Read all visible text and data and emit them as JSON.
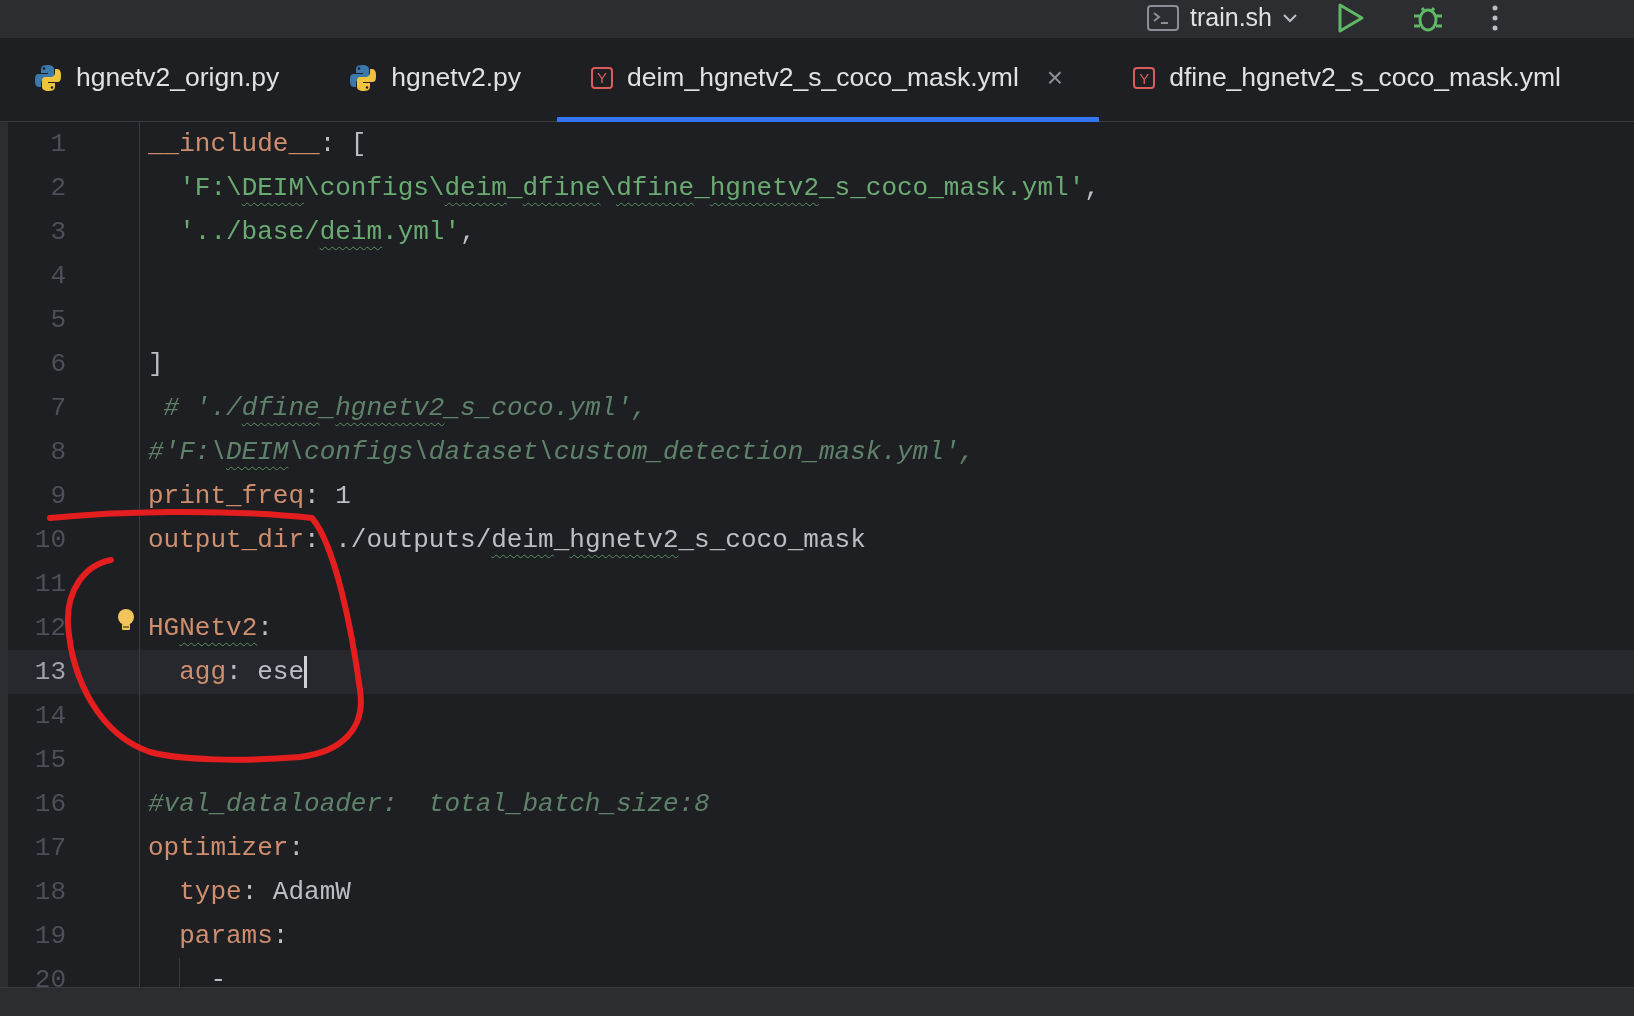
{
  "toolbar": {
    "run_config": {
      "label": "train.sh"
    },
    "buttons": [
      {
        "kind": "run"
      },
      {
        "kind": "debug"
      },
      {
        "kind": "more"
      }
    ]
  },
  "tabs": [
    {
      "label": "hgnetv2_orign.py",
      "kind": "python",
      "selected": false
    },
    {
      "label": "hgnetv2.py",
      "kind": "python",
      "selected": false
    },
    {
      "label": "deim_hgnetv2_s_coco_mask.yml",
      "kind": "yaml",
      "badge": "Y",
      "selected": true,
      "close": "×"
    },
    {
      "label": "dfine_hgnetv2_s_coco_mask.yml",
      "kind": "yaml",
      "badge": "Y",
      "selected": false
    }
  ],
  "lines": [
    {
      "number": "1",
      "current": false,
      "tokens": [
        {
          "text": "__include__",
          "kind": "key"
        },
        {
          "text": ": [",
          "kind": "punct"
        }
      ]
    },
    {
      "number": "2",
      "current": false,
      "tokens": [
        {
          "text": "  'F:\\",
          "kind": "string"
        },
        {
          "text": "DEIM",
          "kind": "string",
          "typo": true
        },
        {
          "text": "\\configs\\",
          "kind": "string"
        },
        {
          "text": "deim",
          "kind": "string",
          "typo": true
        },
        {
          "text": "_",
          "kind": "string"
        },
        {
          "text": "dfine",
          "kind": "string",
          "typo": true
        },
        {
          "text": "\\",
          "kind": "string"
        },
        {
          "text": "dfine",
          "kind": "string",
          "typo": true
        },
        {
          "text": "_",
          "kind": "string"
        },
        {
          "text": "hgnetv2",
          "kind": "string",
          "typo": true
        },
        {
          "text": "_s_coco_mask.yml'",
          "kind": "string"
        },
        {
          "text": ",",
          "kind": "punct"
        }
      ]
    },
    {
      "number": "3",
      "current": false,
      "tokens": [
        {
          "text": "  '../base/",
          "kind": "string"
        },
        {
          "text": "deim",
          "kind": "string",
          "typo": true
        },
        {
          "text": ".yml'",
          "kind": "string"
        },
        {
          "text": ",",
          "kind": "punct"
        }
      ]
    },
    {
      "number": "4",
      "current": false
    },
    {
      "number": "5",
      "current": false
    },
    {
      "number": "6",
      "current": false,
      "tokens": [
        {
          "text": "]",
          "kind": "punct"
        }
      ]
    },
    {
      "number": "7",
      "current": false,
      "tokens": [
        {
          "text": " # './",
          "kind": "comment"
        },
        {
          "text": "dfine",
          "kind": "comment",
          "typo": true
        },
        {
          "text": "_",
          "kind": "comment"
        },
        {
          "text": "hgnetv2",
          "kind": "comment",
          "typo": true
        },
        {
          "text": "_s_coco.yml',",
          "kind": "comment"
        }
      ]
    },
    {
      "number": "8",
      "current": false,
      "tokens": [
        {
          "text": "#'F:\\",
          "kind": "comment"
        },
        {
          "text": "DEIM",
          "kind": "comment",
          "typo": true
        },
        {
          "text": "\\configs\\dataset\\custom_detection_mask.yml',",
          "kind": "comment"
        }
      ]
    },
    {
      "number": "9",
      "current": false,
      "tokens": [
        {
          "text": "print_freq",
          "kind": "key"
        },
        {
          "text": ": 1",
          "kind": "punct"
        }
      ]
    },
    {
      "number": "10",
      "current": false,
      "tokens": [
        {
          "text": "output_dir",
          "kind": "key"
        },
        {
          "text": ": ./outputs/",
          "kind": "punct"
        },
        {
          "text": "deim",
          "kind": "punct",
          "typo": true
        },
        {
          "text": "_",
          "kind": "punct"
        },
        {
          "text": "hgnetv2",
          "kind": "punct",
          "typo": true
        },
        {
          "text": "_s_coco_mask",
          "kind": "punct"
        }
      ]
    },
    {
      "number": "11",
      "current": false
    },
    {
      "number": "12",
      "current": false,
      "tokens": [
        {
          "text": "HG",
          "kind": "key"
        },
        {
          "text": "Netv2",
          "kind": "key",
          "typo": true
        },
        {
          "text": ":",
          "kind": "punct"
        }
      ],
      "hint": true
    },
    {
      "number": "13",
      "current": true,
      "tokens": [
        {
          "text": "  agg",
          "kind": "key"
        },
        {
          "text": ": ese",
          "kind": "punct"
        }
      ]
    },
    {
      "number": "14",
      "current": false
    },
    {
      "number": "15",
      "current": false
    },
    {
      "number": "16",
      "current": false,
      "tokens": [
        {
          "text": "#val_dataloader:  total_batch_size:8",
          "kind": "comment"
        }
      ]
    },
    {
      "number": "17",
      "current": false,
      "tokens": [
        {
          "text": "optimizer",
          "kind": "key"
        },
        {
          "text": ":",
          "kind": "punct"
        }
      ]
    },
    {
      "number": "18",
      "current": false,
      "tokens": [
        {
          "text": "  type",
          "kind": "key"
        },
        {
          "text": ": AdamW",
          "kind": "punct"
        }
      ]
    },
    {
      "number": "19",
      "current": false,
      "tokens": [
        {
          "text": "  params",
          "kind": "key"
        },
        {
          "text": ":",
          "kind": "punct"
        }
      ]
    },
    {
      "number": "20",
      "current": false,
      "tokens": [
        {
          "text": "    -",
          "kind": "punct"
        }
      ],
      "guide": true
    }
  ],
  "annotations": [
    {
      "kind": "circle"
    }
  ]
}
